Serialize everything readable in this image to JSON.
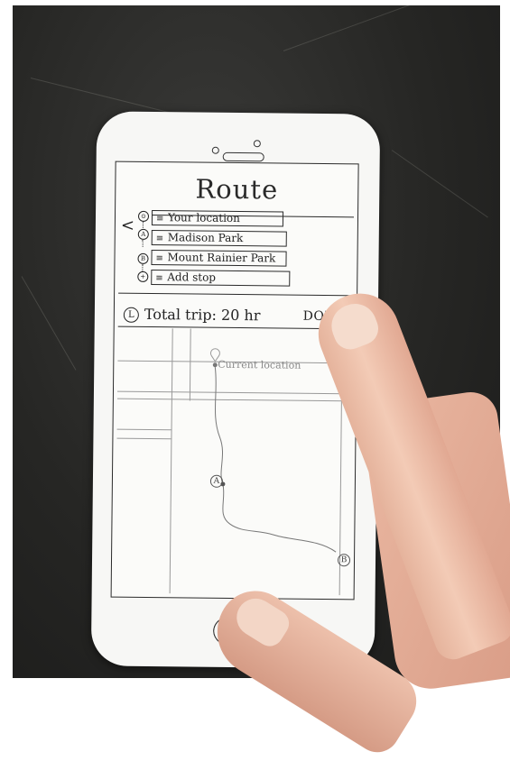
{
  "screen": {
    "title": "Route",
    "stops": [
      {
        "marker": "⊙",
        "label": "Your location"
      },
      {
        "marker": "A",
        "label": "Madison Park"
      },
      {
        "marker": "B",
        "label": "Mount Rainier Park"
      },
      {
        "marker": "+",
        "label": "Add stop"
      }
    ],
    "trip_summary": "Total trip: 20 hr",
    "done_label": "DONE",
    "map": {
      "current_location_label": "Current location",
      "point_a_label": "A",
      "point_b_label": "B"
    }
  },
  "icons": {
    "back": "<",
    "handle": "≡",
    "clock": "L"
  }
}
